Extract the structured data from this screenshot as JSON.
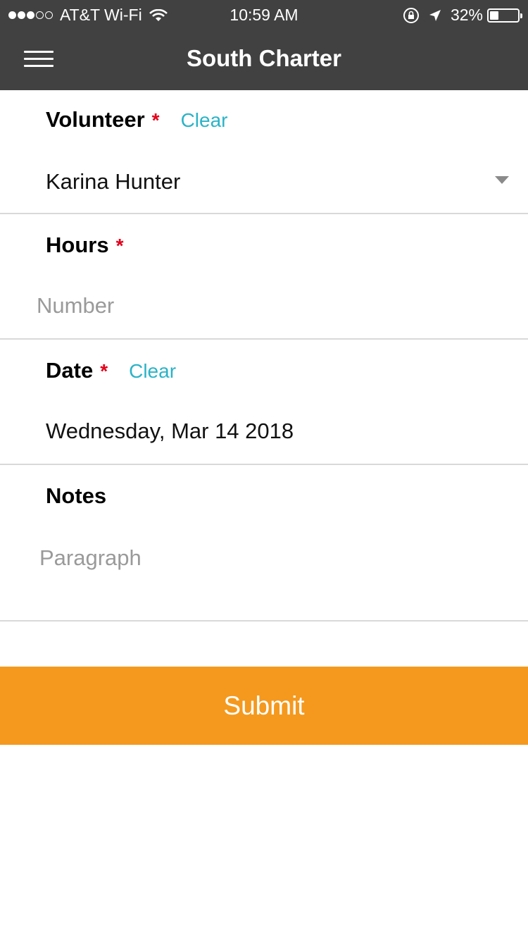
{
  "status_bar": {
    "carrier": "AT&T Wi-Fi",
    "time": "10:59 AM",
    "battery_percent": "32%",
    "battery_level": 0.32,
    "signal_bars_filled": 3,
    "signal_bars_total": 5
  },
  "nav": {
    "title": "South Charter",
    "menu_icon": "hamburger-menu-icon"
  },
  "form": {
    "volunteer": {
      "label": "Volunteer",
      "required_mark": "*",
      "clear_label": "Clear",
      "value": "Karina Hunter"
    },
    "hours": {
      "label": "Hours",
      "required_mark": "*",
      "placeholder": "Number",
      "value": ""
    },
    "date": {
      "label": "Date",
      "required_mark": "*",
      "clear_label": "Clear",
      "value": "Wednesday, Mar 14 2018"
    },
    "notes": {
      "label": "Notes",
      "placeholder": "Paragraph",
      "value": ""
    }
  },
  "submit_label": "Submit",
  "colors": {
    "header_bg": "#414141",
    "accent_link": "#2bb3c7",
    "required": "#e3001b",
    "submit_bg": "#f4991e"
  }
}
